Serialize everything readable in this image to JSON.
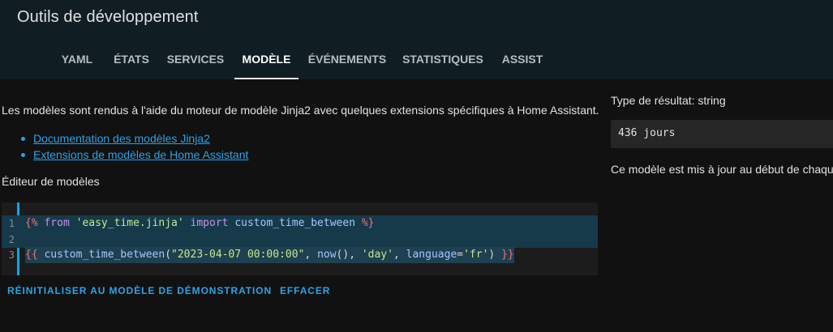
{
  "header": {
    "title": "Outils de développement"
  },
  "tabs": [
    {
      "label": "YAML"
    },
    {
      "label": "ÉTATS"
    },
    {
      "label": "SERVICES"
    },
    {
      "label": "MODÈLE"
    },
    {
      "label": "ÉVÉNEMENTS"
    },
    {
      "label": "STATISTIQUES"
    },
    {
      "label": "ASSIST"
    }
  ],
  "active_tab": "MODÈLE",
  "intro": {
    "text": "Les modèles sont rendus à l'aide du moteur de modèle Jinja2 avec quelques extensions spécifiques à Home Assistant.",
    "links": [
      {
        "label": "Documentation des modèles Jinja2"
      },
      {
        "label": "Extensions de modèles de Home Assistant"
      }
    ]
  },
  "editor": {
    "label": "Éditeur de modèles",
    "lines": [
      {
        "number": "1",
        "tokens": [
          {
            "t": "{%",
            "c": "delim"
          },
          {
            "t": " ",
            "c": "plain"
          },
          {
            "t": "from",
            "c": "kw"
          },
          {
            "t": " ",
            "c": "plain"
          },
          {
            "t": "'easy_time.jinja'",
            "c": "str"
          },
          {
            "t": " ",
            "c": "plain"
          },
          {
            "t": "import",
            "c": "kw"
          },
          {
            "t": " ",
            "c": "plain"
          },
          {
            "t": "custom_time_between",
            "c": "id"
          },
          {
            "t": " ",
            "c": "plain"
          },
          {
            "t": "%}",
            "c": "delim"
          }
        ]
      },
      {
        "number": "2",
        "tokens": []
      },
      {
        "number": "3",
        "tokens": [
          {
            "t": "{{",
            "c": "delim"
          },
          {
            "t": " ",
            "c": "plain"
          },
          {
            "t": "custom_time_between",
            "c": "id"
          },
          {
            "t": "(",
            "c": "plain"
          },
          {
            "t": "\"2023-04-07 00:00:00\"",
            "c": "str"
          },
          {
            "t": ", ",
            "c": "plain"
          },
          {
            "t": "now",
            "c": "id"
          },
          {
            "t": "(), ",
            "c": "plain"
          },
          {
            "t": "'day'",
            "c": "str"
          },
          {
            "t": ", ",
            "c": "plain"
          },
          {
            "t": "language",
            "c": "id"
          },
          {
            "t": "=",
            "c": "plain"
          },
          {
            "t": "'fr'",
            "c": "str"
          },
          {
            "t": ") ",
            "c": "plain"
          },
          {
            "t": "}}",
            "c": "delim"
          }
        ]
      }
    ]
  },
  "actions": {
    "reset_label": "RÉINITIALISER AU MODÈLE DE DÉMONSTRATION",
    "clear_label": "EFFACER"
  },
  "result": {
    "type_text": "Type de résultat: string",
    "value": "436 jours",
    "note": "Ce modèle est mis à jour au début de chaque minute."
  },
  "colors": {
    "header_bg": "#101e24",
    "page_bg": "#111111",
    "accent": "#03a9f4",
    "link": "#2aa3e8"
  }
}
